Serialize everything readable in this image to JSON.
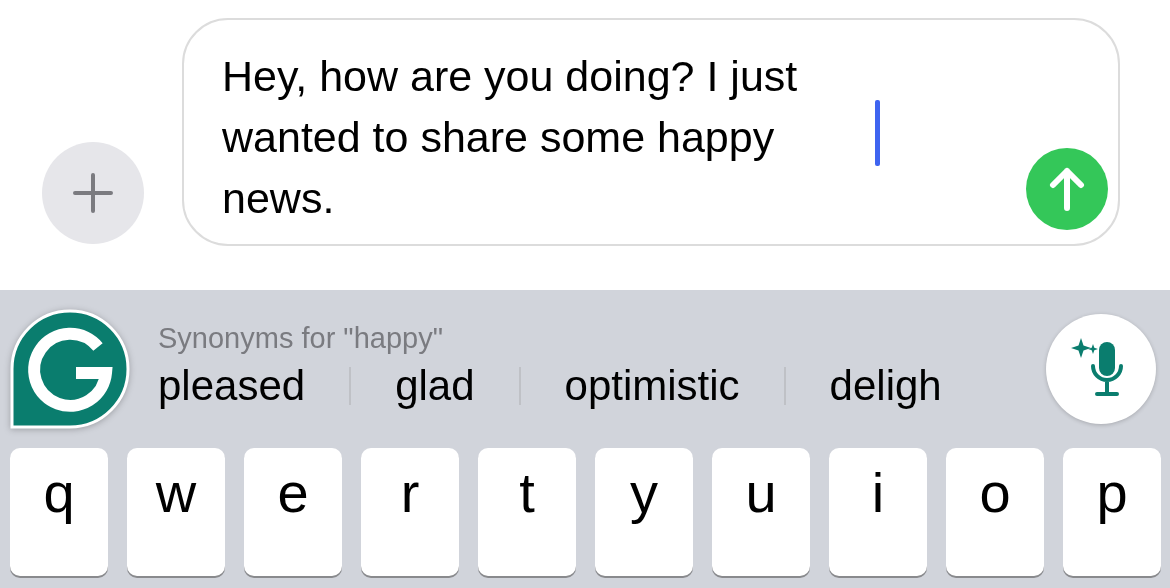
{
  "composer": {
    "value": "Hey, how are you doing? I just\nwanted to share some happy\nnews."
  },
  "suggestions": {
    "title": "Synonyms for \"happy\"",
    "words": [
      "pleased",
      "glad",
      "optimistic",
      "deligh"
    ]
  },
  "keys": [
    "q",
    "w",
    "e",
    "r",
    "t",
    "y",
    "u",
    "i",
    "o",
    "p"
  ]
}
